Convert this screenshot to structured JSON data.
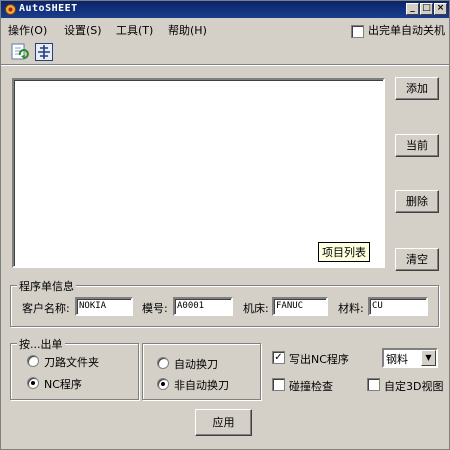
{
  "window": {
    "title": "AutoSHEET",
    "min": "_",
    "max": "□",
    "close": "×"
  },
  "menu": {
    "items": [
      "操作(O)",
      "设置(S)",
      "工具(T)",
      "帮助(H)"
    ],
    "autoshut_label": "出完单自动关机"
  },
  "toolbar": {
    "icons": [
      "refresh-icon",
      "settings-icon"
    ]
  },
  "list": {
    "tag": "项目列表"
  },
  "side_buttons": [
    "添加",
    "当前",
    "删除",
    "清空"
  ],
  "info": {
    "legend": "程序单信息",
    "customer_label": "客户名称:",
    "customer_value": "NOKIA",
    "mold_label": "模号:",
    "mold_value": "A0001",
    "machine_label": "机床:",
    "machine_value": "FANUC",
    "material_label": "材料:",
    "material_value": "CU"
  },
  "output": {
    "legend": "按...出单",
    "option_folder": "刀路文件夹",
    "option_nc": "NC程序",
    "selected": "NC程序"
  },
  "toolchange": {
    "option_auto": "自动换刀",
    "option_manual": "非自动换刀",
    "selected": "非自动换刀"
  },
  "options": {
    "write_nc": "写出NC程序",
    "write_nc_checked": true,
    "collision": "碰撞检查",
    "collision_checked": false,
    "custom3d": "自定3D视图",
    "custom3d_checked": false,
    "steel_selected": "钢料"
  },
  "apply_label": "应用",
  "colors": {
    "title_bar": "#0a246a",
    "face": "#d4d0c8",
    "tooltip": "#ffffe1"
  }
}
